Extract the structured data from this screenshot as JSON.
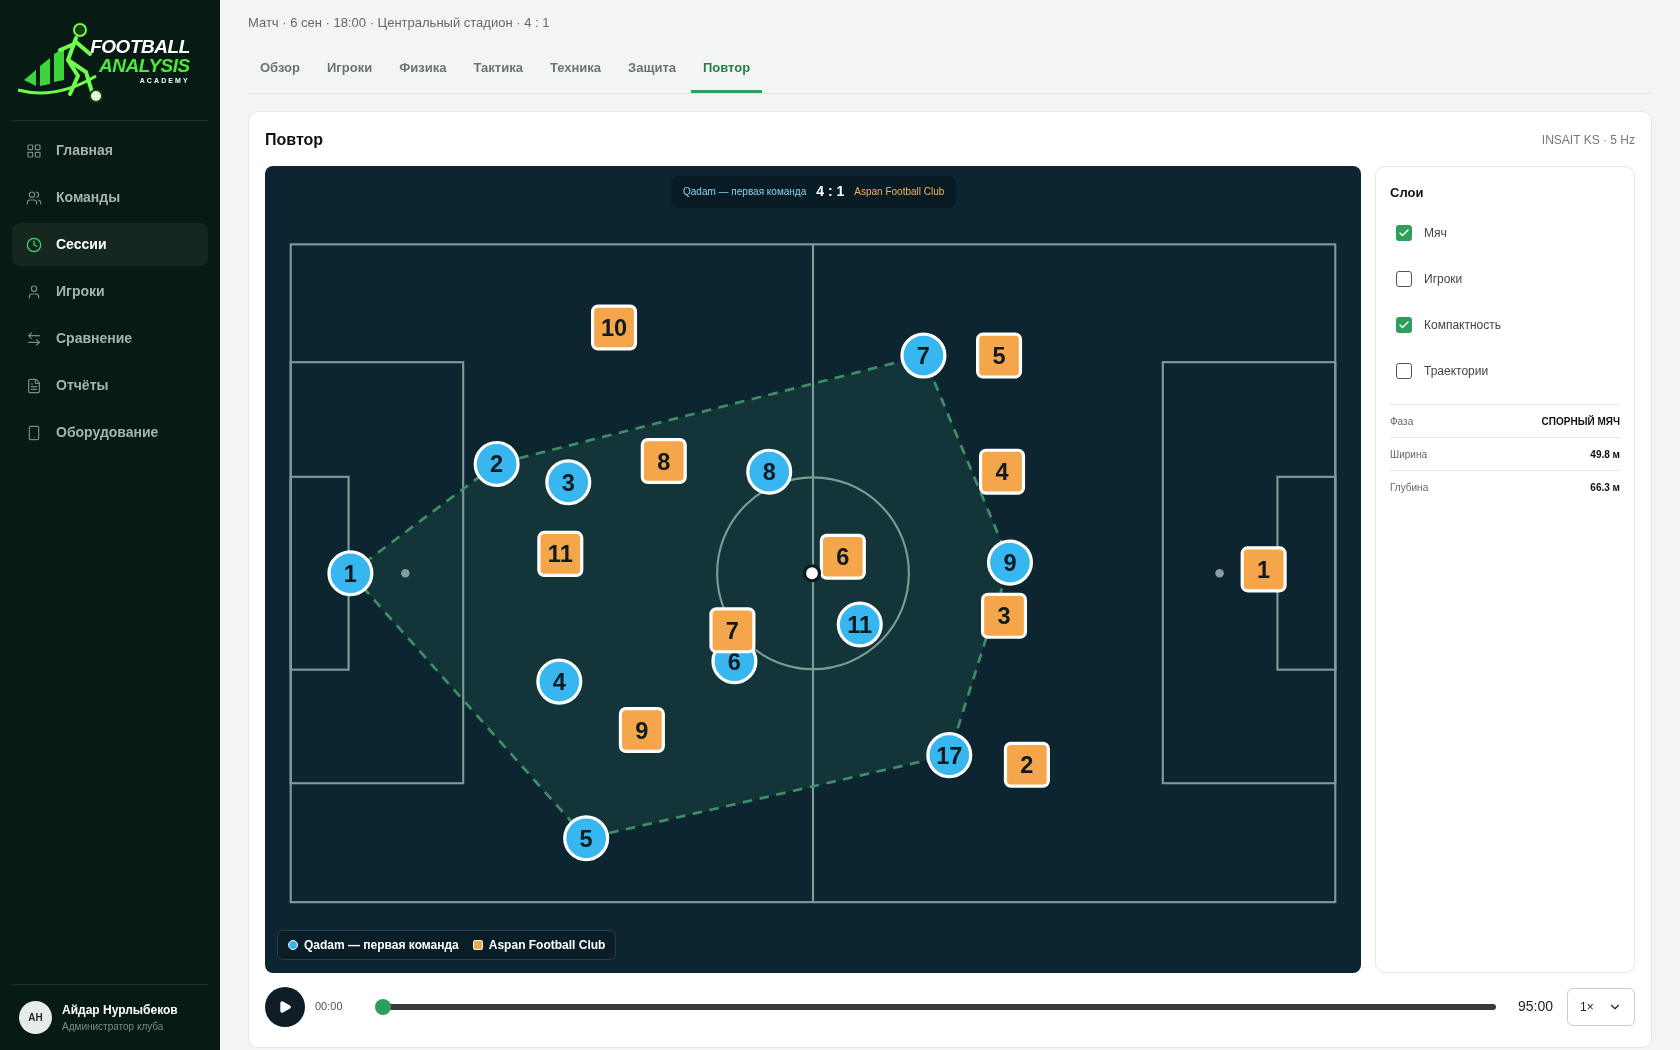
{
  "logo": {
    "line1": "FOOTBALL",
    "line2": "ANALYSIS",
    "line3": "ACADEMY"
  },
  "sidebar": {
    "items": [
      {
        "label": "Главная",
        "selected": false
      },
      {
        "label": "Команды",
        "selected": false
      },
      {
        "label": "Сессии",
        "selected": true
      },
      {
        "label": "Игроки",
        "selected": false
      },
      {
        "label": "Сравнение",
        "selected": false
      },
      {
        "label": "Отчёты",
        "selected": false
      },
      {
        "label": "Оборудование",
        "selected": false
      }
    ],
    "user": {
      "initials": "АН",
      "name": "Айдар Нурлыбеков",
      "role": "Администратор клуба"
    }
  },
  "header": {
    "subtitle": "Матч · 6 сен · 18:00 · Центральный стадион · 4 : 1"
  },
  "tabs": [
    {
      "label": "Обзор",
      "selected": false
    },
    {
      "label": "Игроки",
      "selected": false
    },
    {
      "label": "Физика",
      "selected": false
    },
    {
      "label": "Тактика",
      "selected": false
    },
    {
      "label": "Техника",
      "selected": false
    },
    {
      "label": "Защита",
      "selected": false
    },
    {
      "label": "Повтор",
      "selected": true
    }
  ],
  "replay": {
    "title": "Повтор",
    "source": "INSAIT KS · 5 Hz",
    "scoreboard": {
      "home": "Qadam — первая команда",
      "score": "4 : 1",
      "away": "Aspan Football Club"
    },
    "legend": [
      {
        "label": "Qadam — первая команда",
        "kind": "home"
      },
      {
        "label": "Aspan Football Club",
        "kind": "away"
      }
    ],
    "players": [
      {
        "kind": "home",
        "number": "1"
      },
      {
        "kind": "home",
        "number": "2"
      },
      {
        "kind": "home",
        "number": "3"
      },
      {
        "kind": "home",
        "number": "8"
      },
      {
        "kind": "home",
        "number": "7"
      },
      {
        "kind": "home",
        "number": "9"
      },
      {
        "kind": "home",
        "number": "11"
      },
      {
        "kind": "home",
        "number": "6"
      },
      {
        "kind": "home",
        "number": "4"
      },
      {
        "kind": "home",
        "number": "5"
      },
      {
        "kind": "home",
        "number": "17"
      },
      {
        "kind": "away",
        "number": "10"
      },
      {
        "kind": "away",
        "number": "5"
      },
      {
        "kind": "away",
        "number": "8"
      },
      {
        "kind": "away",
        "number": "4"
      },
      {
        "kind": "away",
        "number": "11"
      },
      {
        "kind": "away",
        "number": "6"
      },
      {
        "kind": "away",
        "number": "7"
      },
      {
        "kind": "away",
        "number": "3"
      },
      {
        "kind": "away",
        "number": "9"
      },
      {
        "kind": "away",
        "number": "2"
      },
      {
        "kind": "away",
        "number": "1"
      }
    ],
    "layers": {
      "title": "Слои",
      "items": [
        {
          "label": "Мяч",
          "kind": "ball",
          "checked": true
        },
        {
          "label": "Игроки",
          "kind": "players",
          "checked": false
        },
        {
          "label": "Компактность",
          "kind": "compactness",
          "checked": true
        },
        {
          "label": "Траектории",
          "kind": "trails",
          "checked": false
        }
      ]
    },
    "stats": [
      {
        "label": "Фаза",
        "value": "СПОРНЫЙ МЯЧ"
      },
      {
        "label": "Ширина",
        "value": "49.8 м"
      },
      {
        "label": "Глубина",
        "value": "66.3 м"
      }
    ],
    "player_bar": {
      "current": "00:00",
      "total": "95:00",
      "level": 0,
      "speed": "1×"
    }
  }
}
